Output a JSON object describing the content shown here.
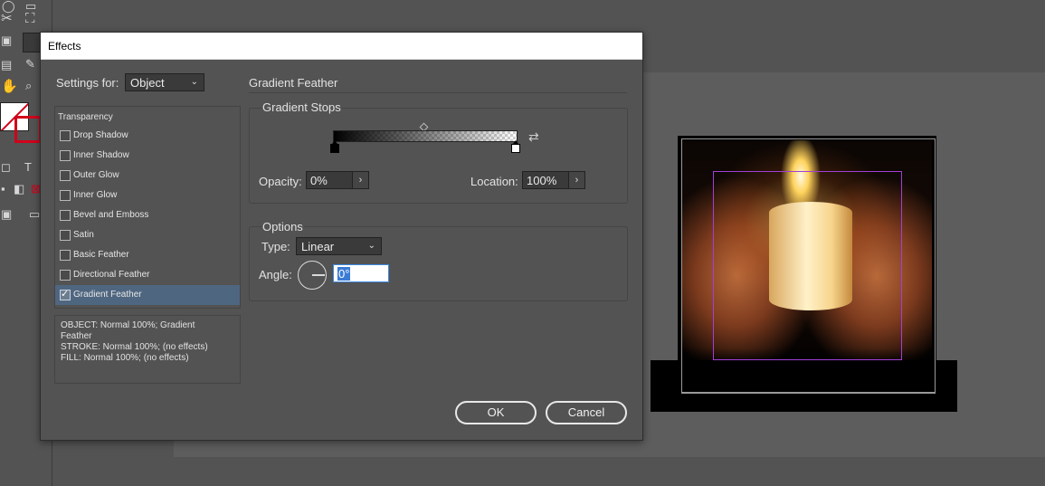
{
  "dialog": {
    "title": "Effects",
    "settings_for_label": "Settings for:",
    "settings_for_value": "Object",
    "effects_list": {
      "header": "Transparency",
      "items": [
        {
          "label": "Drop Shadow",
          "checked": false
        },
        {
          "label": "Inner Shadow",
          "checked": false
        },
        {
          "label": "Outer Glow",
          "checked": false
        },
        {
          "label": "Inner Glow",
          "checked": false
        },
        {
          "label": "Bevel and Emboss",
          "checked": false
        },
        {
          "label": "Satin",
          "checked": false
        },
        {
          "label": "Basic Feather",
          "checked": false
        },
        {
          "label": "Directional Feather",
          "checked": false
        },
        {
          "label": "Gradient Feather",
          "checked": true
        }
      ]
    },
    "summary": {
      "line1": "OBJECT: Normal 100%; Gradient",
      "line2": "Feather",
      "line3": "STROKE: Normal 100%; (no effects)",
      "line4": "FILL: Normal 100%; (no effects)"
    },
    "panel_title": "Gradient Feather",
    "gradient_stops": {
      "title": "Gradient Stops",
      "opacity_label": "Opacity:",
      "opacity_value": "0%",
      "location_label": "Location:",
      "location_value": "100%"
    },
    "options": {
      "title": "Options",
      "type_label": "Type:",
      "type_value": "Linear",
      "angle_label": "Angle:",
      "angle_value": "0°"
    },
    "ok_label": "OK",
    "cancel_label": "Cancel"
  },
  "toolbar": {
    "type_tool_glyph": "T"
  }
}
